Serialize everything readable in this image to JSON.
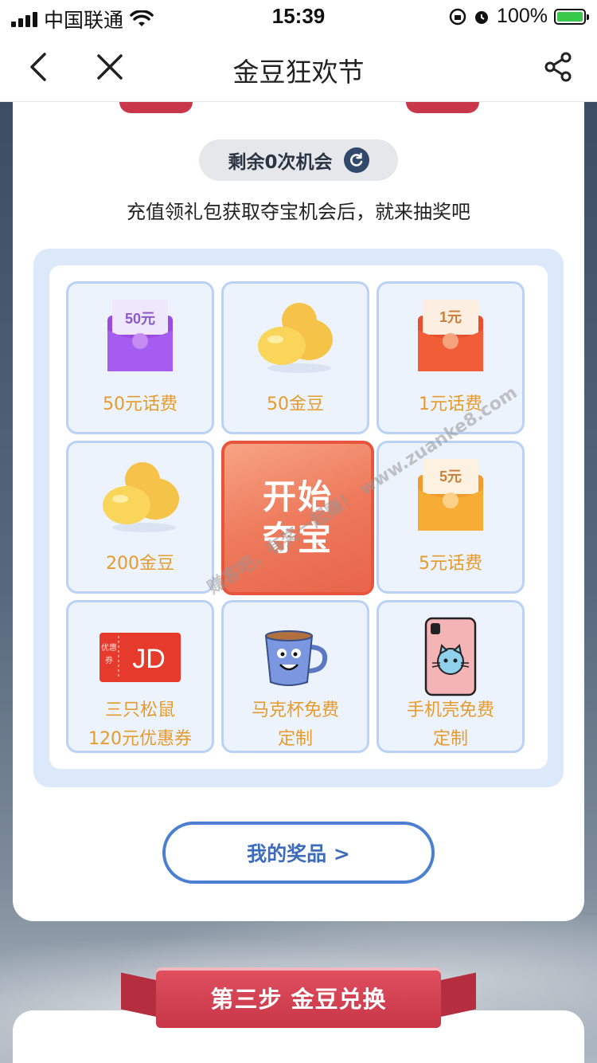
{
  "status_bar": {
    "carrier": "中国联通",
    "time": "15:39",
    "battery": "100%"
  },
  "nav": {
    "title": "金豆狂欢节"
  },
  "lottery": {
    "chances_text": "剩余0次机会",
    "hint": "充值领礼包获取夺宝机会后，就来抽奖吧",
    "start_button": "开始夺宝",
    "prizes": [
      {
        "label": "50元话费",
        "icon": "purple-red-envelope-icon",
        "badge": "50元"
      },
      {
        "label": "50金豆",
        "icon": "gold-beans-icon"
      },
      {
        "label": "1元话费",
        "icon": "red-envelope-icon",
        "badge": "1元"
      },
      {
        "label": "200金豆",
        "icon": "gold-beans-icon"
      },
      {
        "label": "5元话费",
        "icon": "orange-envelope-icon",
        "badge": "5元"
      },
      {
        "label_line1": "三只松鼠",
        "label_line2": "120元优惠券",
        "icon": "jd-coupon-icon",
        "coupon_tag": "优惠券",
        "coupon_brand": "JD"
      },
      {
        "label_line1": "马克杯免费",
        "label_line2": "定制",
        "icon": "mug-icon"
      },
      {
        "label_line1": "手机壳免费",
        "label_line2": "定制",
        "icon": "phone-case-icon"
      }
    ],
    "my_prizes_button": "我的奖品 >"
  },
  "watermark": "赚客吧，有奖一起赚！ www.zuanke8.com",
  "step3": {
    "banner": "第三步 金豆兑换"
  },
  "colors": {
    "accent_blue": "#4a7fd1",
    "prize_text": "#e59b2d",
    "start_button": "#ee7a5c",
    "banner_red": "#c83648"
  }
}
